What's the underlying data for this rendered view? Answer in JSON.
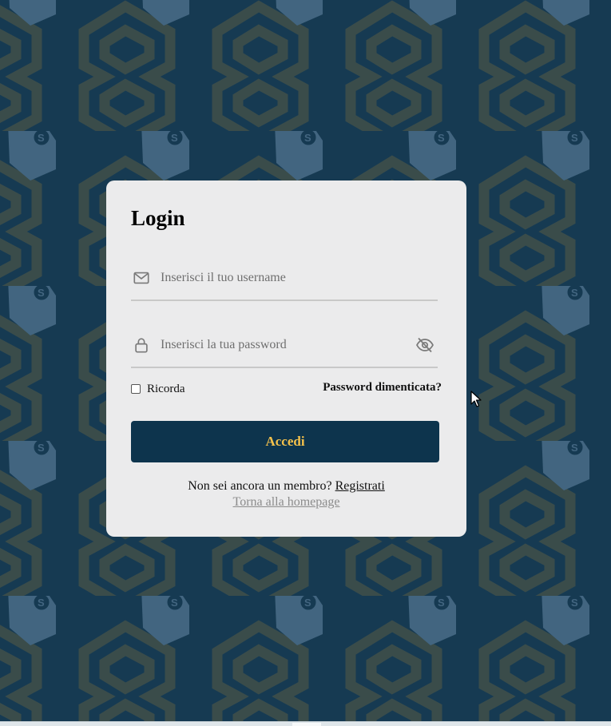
{
  "page": {
    "background_color": "#163a52",
    "pattern_colors": {
      "outline": "#3a4c4a",
      "tag": "#426580"
    }
  },
  "login": {
    "title": "Login",
    "username": {
      "placeholder": "Inserisci il tuo username",
      "value": "",
      "icon": "mail-icon"
    },
    "password": {
      "placeholder": "Inserisci la tua password",
      "value": "",
      "icon": "lock-icon",
      "toggle_icon": "eye-off-icon"
    },
    "remember_label": "Ricorda",
    "remember_checked": false,
    "forgot_label": "Password dimenticata?",
    "submit_label": "Accedi",
    "signup_prompt": "Non sei ancora un membro?",
    "signup_link": "Registrati",
    "home_link": "Torna alla homepage",
    "colors": {
      "card": "#ebebec",
      "button": "#0d344d",
      "button_text": "#f4c14b",
      "home_link": "#8c8c8c"
    }
  }
}
